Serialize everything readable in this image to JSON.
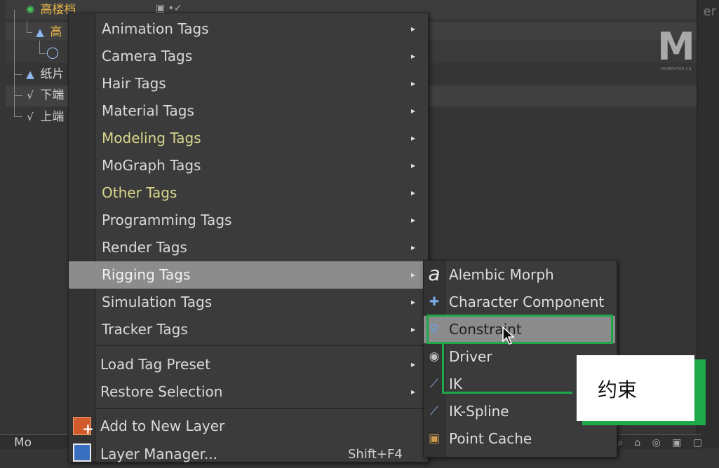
{
  "object_manager": {
    "rows": [
      {
        "label": "高楼档",
        "icon": "null-object-icon"
      },
      {
        "label": "高",
        "icon": "cone-icon"
      },
      {
        "label": "",
        "icon": "circle-spline-icon"
      },
      {
        "label": "纸片",
        "icon": "cone-icon"
      },
      {
        "label": "下端",
        "icon": "spline-icon"
      },
      {
        "label": "上端",
        "icon": "spline-icon"
      }
    ],
    "right_edge_text": "er",
    "bottom_label": "Mo",
    "bottom_icons": "⌕ ⌂ ◎ ▣ ▢"
  },
  "logo": {
    "mark": "M",
    "subtitle": "MOMENTOR.CN"
  },
  "main_menu": {
    "items": [
      {
        "label": "Animation Tags",
        "has_submenu": true,
        "style": "normal"
      },
      {
        "label": "Camera Tags",
        "has_submenu": true,
        "style": "normal"
      },
      {
        "label": "Hair Tags",
        "has_submenu": true,
        "style": "normal"
      },
      {
        "label": "Material Tags",
        "has_submenu": true,
        "style": "normal"
      },
      {
        "label": "Modeling Tags",
        "has_submenu": true,
        "style": "yellow"
      },
      {
        "label": "MoGraph Tags",
        "has_submenu": true,
        "style": "normal"
      },
      {
        "label": "Other Tags",
        "has_submenu": true,
        "style": "yellow"
      },
      {
        "label": "Programming Tags",
        "has_submenu": true,
        "style": "normal"
      },
      {
        "label": "Render Tags",
        "has_submenu": true,
        "style": "normal"
      },
      {
        "label": "Rigging Tags",
        "has_submenu": true,
        "style": "highlight"
      },
      {
        "label": "Simulation Tags",
        "has_submenu": true,
        "style": "normal"
      },
      {
        "label": "Tracker Tags",
        "has_submenu": true,
        "style": "normal"
      }
    ],
    "group2": [
      {
        "label": "Load Tag Preset",
        "has_submenu": true
      },
      {
        "label": "Restore Selection",
        "has_submenu": true
      }
    ],
    "group3": [
      {
        "label": "Add to New Layer",
        "icon": "add-layer-icon"
      },
      {
        "label": "Layer Manager...",
        "icon": "layer-manager-icon",
        "shortcut": "Shift+F4"
      }
    ],
    "arrow_glyph": "▸"
  },
  "sub_menu": {
    "items": [
      {
        "label": "Alembic Morph",
        "icon": "alembic-icon",
        "glyph": "a"
      },
      {
        "label": "Character Component",
        "icon": "puzzle-icon",
        "glyph": "✚"
      },
      {
        "label": "Constraint",
        "icon": "constraint-icon",
        "glyph": "⚲",
        "highlight": true
      },
      {
        "label": "Driver",
        "icon": "driver-icon",
        "glyph": "◉"
      },
      {
        "label": "IK",
        "icon": "ik-icon",
        "glyph": "⟋"
      },
      {
        "label": "IK-Spline",
        "icon": "ik-spline-icon",
        "glyph": "⟋"
      },
      {
        "label": "Point Cache",
        "icon": "point-cache-icon",
        "glyph": "▣"
      }
    ]
  },
  "annotation": {
    "text": "约束",
    "color": "#1ea84a"
  }
}
